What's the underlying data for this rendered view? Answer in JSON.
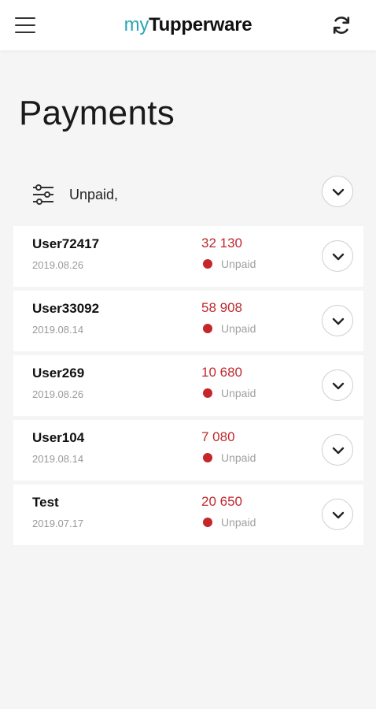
{
  "app": {
    "logo_prefix": "my",
    "logo_brand": "Tupperware"
  },
  "header": {
    "menu_icon": "hamburger-menu-icon",
    "refresh_icon": "refresh-icon"
  },
  "page": {
    "title": "Payments"
  },
  "filter": {
    "icon": "filter-sliders-icon",
    "label": "Unpaid,",
    "expand_icon": "chevron-down-icon"
  },
  "colors": {
    "accent": "#2aa6b3",
    "amount": "#c0282d",
    "status_unpaid": "#c4262b"
  },
  "payments": [
    {
      "name": "User72417",
      "date": "2019.08.26",
      "amount": "32 130",
      "status": "Unpaid"
    },
    {
      "name": "User33092",
      "date": "2019.08.14",
      "amount": "58 908",
      "status": "Unpaid"
    },
    {
      "name": "User269",
      "date": "2019.08.26",
      "amount": "10 680",
      "status": "Unpaid"
    },
    {
      "name": "User104",
      "date": "2019.08.14",
      "amount": "7 080",
      "status": "Unpaid"
    },
    {
      "name": "Test",
      "date": "2019.07.17",
      "amount": "20 650",
      "status": "Unpaid"
    }
  ]
}
